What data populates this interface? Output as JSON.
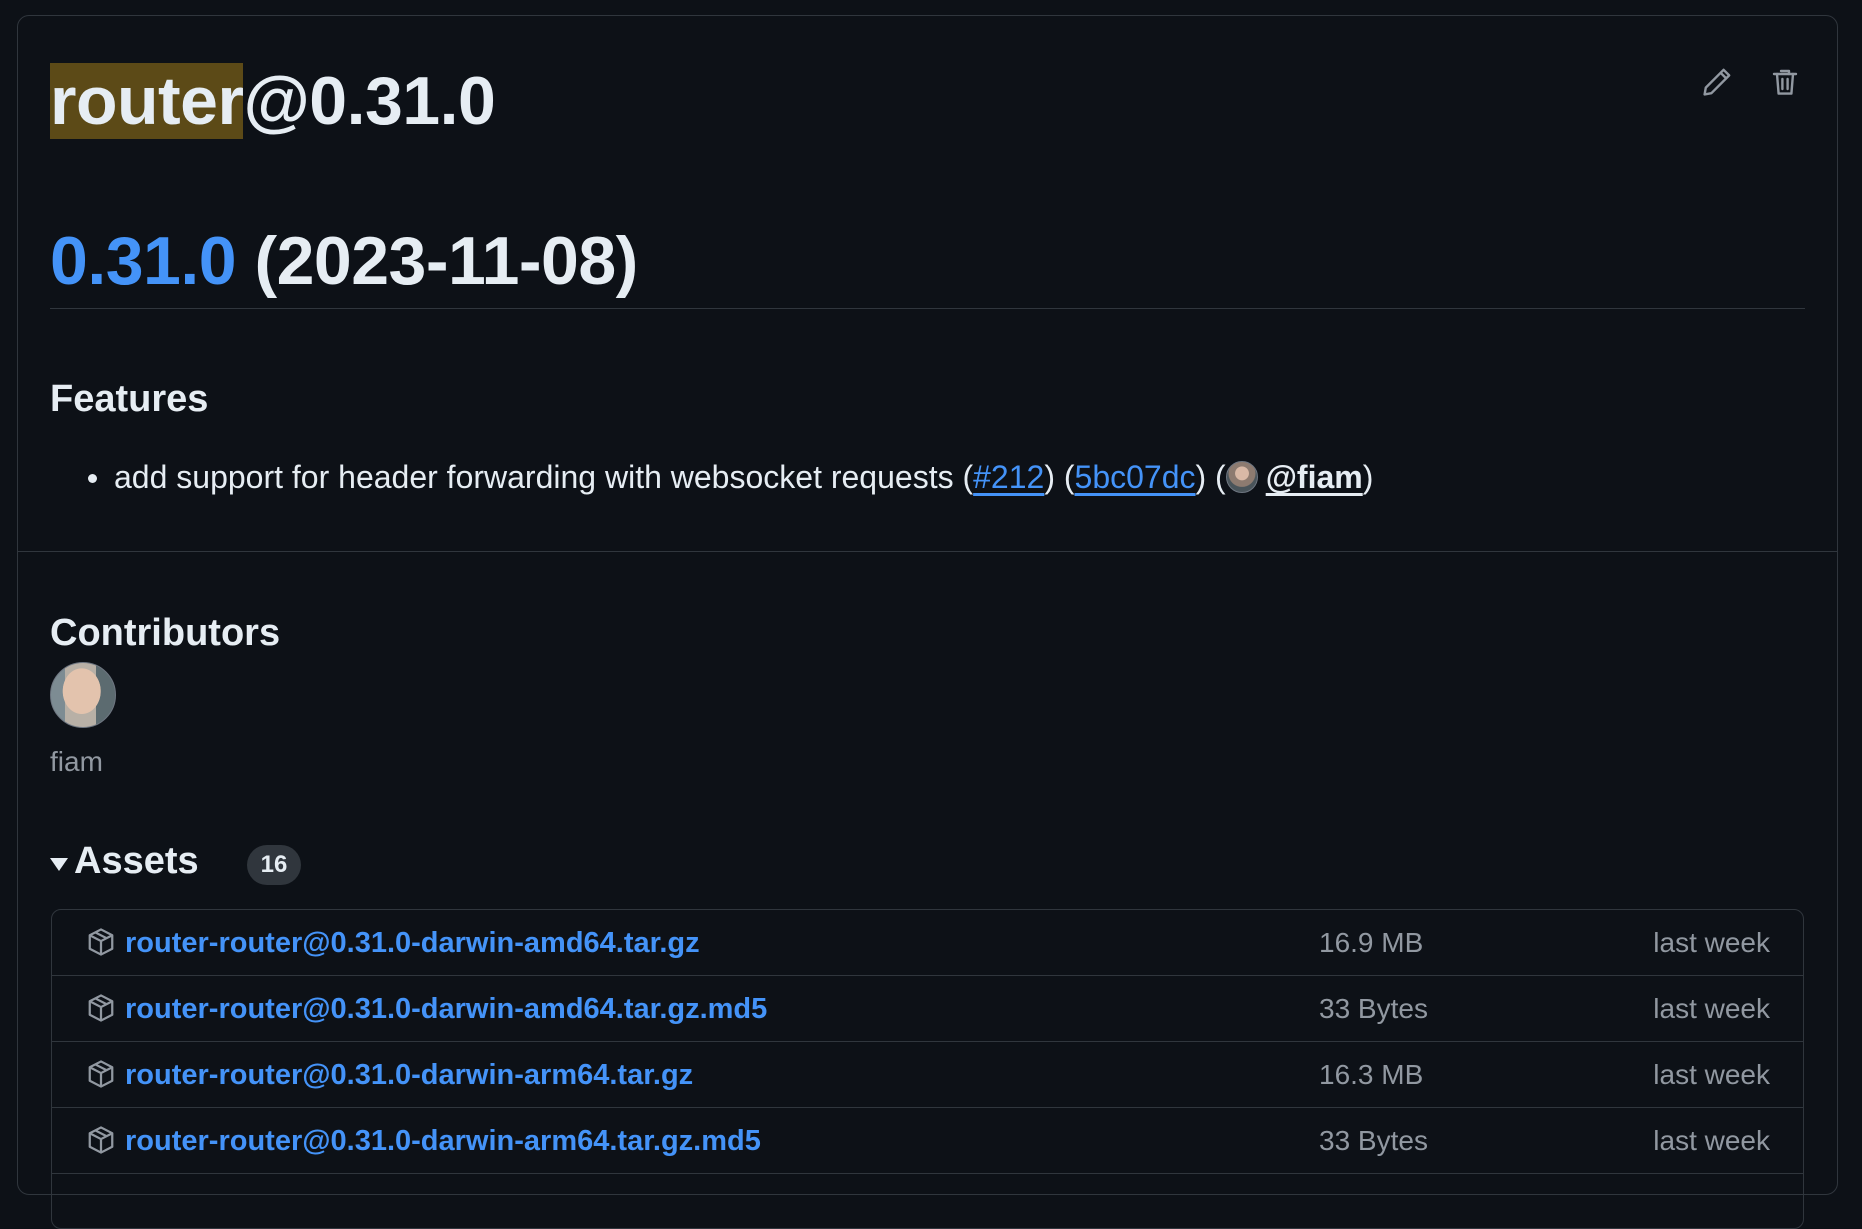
{
  "release": {
    "title_highlight": "router",
    "title_rest": "@0.31.0"
  },
  "actions": [
    {
      "name": "edit-icon",
      "label": "Edit"
    },
    {
      "name": "trash-icon",
      "label": "Delete"
    }
  ],
  "changelog": {
    "version_link": "0.31.0",
    "version_date": " (2023-11-08)",
    "features_heading": "Features",
    "features": [
      {
        "text": "add support for header forwarding with websocket requests (",
        "pr_link": "#212",
        "mid1": ") (",
        "commit_link": "5bc07dc",
        "mid2": ") (",
        "user_link": "@fiam",
        "end": ")"
      }
    ]
  },
  "contributors": {
    "heading": "Contributors",
    "people": [
      {
        "name": "fiam"
      }
    ]
  },
  "assets": {
    "heading": "Assets",
    "count": "16",
    "items": [
      {
        "name": "router-router@0.31.0-darwin-amd64.tar.gz",
        "size": "16.9 MB",
        "date": "last week"
      },
      {
        "name": "router-router@0.31.0-darwin-amd64.tar.gz.md5",
        "size": "33 Bytes",
        "date": "last week"
      },
      {
        "name": "router-router@0.31.0-darwin-arm64.tar.gz",
        "size": "16.3 MB",
        "date": "last week"
      },
      {
        "name": "router-router@0.31.0-darwin-arm64.tar.gz.md5",
        "size": "33 Bytes",
        "date": "last week"
      }
    ]
  },
  "colors": {
    "background": "#0d1117",
    "border": "#30363d",
    "link": "#4493f8",
    "text": "#e6edf3",
    "muted": "#9198a1",
    "highlight": "#5c4a17"
  }
}
